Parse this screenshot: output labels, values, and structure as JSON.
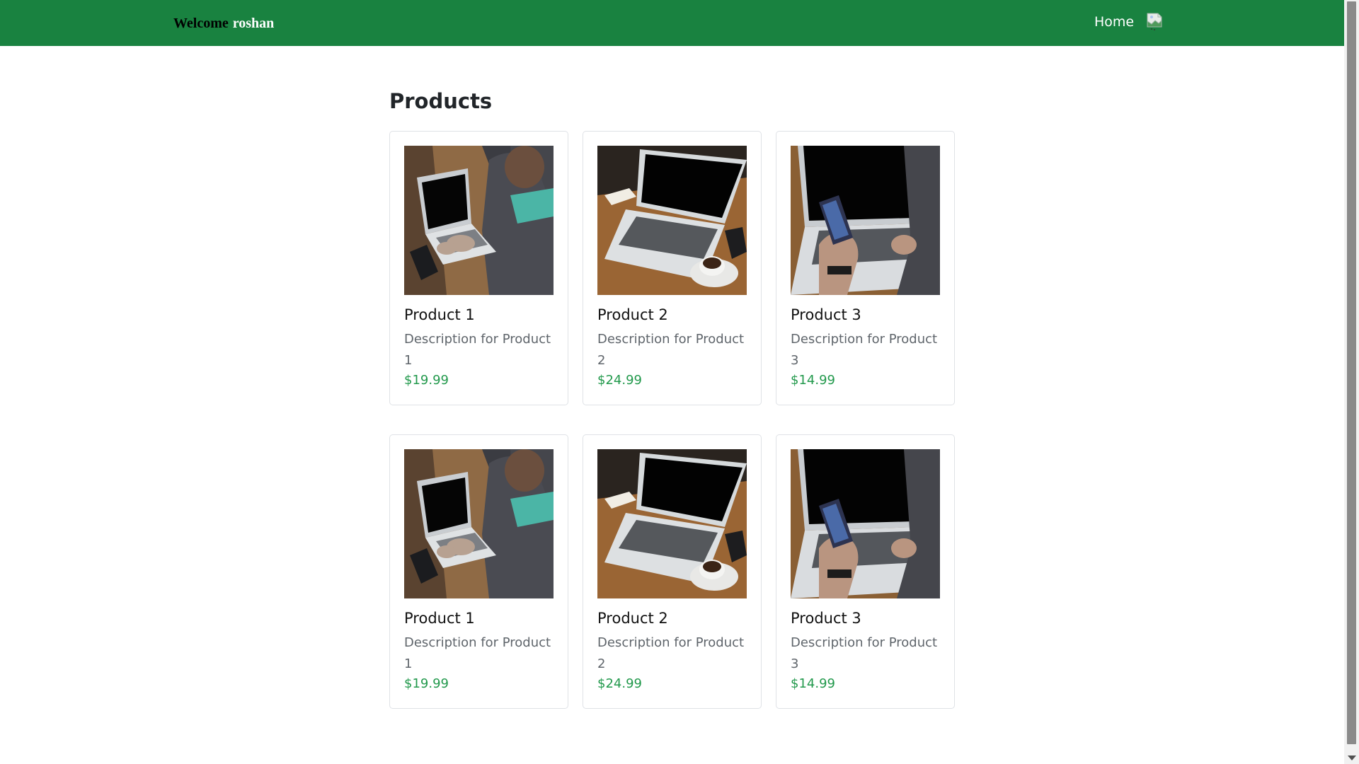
{
  "navbar": {
    "welcome_text": "Welcome",
    "username": "roshan",
    "home_link": "Home",
    "avatar_icon": "broken-image-icon",
    "background_color": "#198240"
  },
  "main": {
    "title": "Products",
    "products": [
      {
        "name": "Product 1",
        "description": "Description for Product 1",
        "price": "$19.99",
        "image": "person-typing-on-laptop"
      },
      {
        "name": "Product 2",
        "description": "Description for Product 2",
        "price": "$24.99",
        "image": "laptop-with-coffee-cup"
      },
      {
        "name": "Product 3",
        "description": "Description for Product 3",
        "price": "$14.99",
        "image": "hand-holding-phone-over-laptop"
      },
      {
        "name": "Product 1",
        "description": "Description for Product 1",
        "price": "$19.99",
        "image": "person-typing-on-laptop"
      },
      {
        "name": "Product 2",
        "description": "Description for Product 2",
        "price": "$24.99",
        "image": "laptop-with-coffee-cup"
      },
      {
        "name": "Product 3",
        "description": "Description for Product 3",
        "price": "$14.99",
        "image": "hand-holding-phone-over-laptop"
      }
    ],
    "price_color": "#22994c"
  }
}
